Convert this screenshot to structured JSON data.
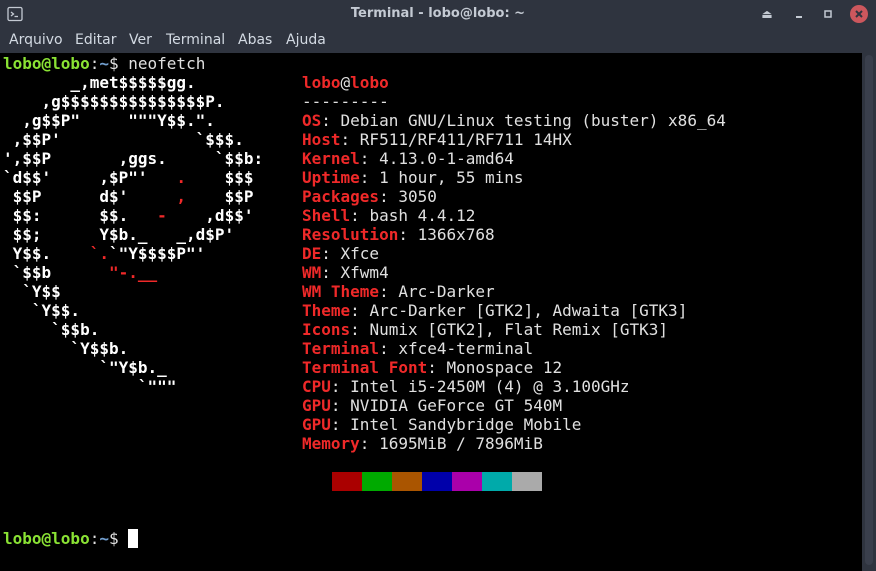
{
  "window": {
    "title": "Terminal - lobo@lobo: ~"
  },
  "menu": [
    "Arquivo",
    "Editar",
    "Ver",
    "Terminal",
    "Abas",
    "Ajuda"
  ],
  "prompt": {
    "user": "lobo@lobo",
    "sep": ":",
    "path": "~",
    "sigil": "$",
    "command": "neofetch"
  },
  "ascii_logo": [
    {
      "parts": [
        {
          "t": "       _,met$$$$$gg.",
          "c": "w"
        }
      ]
    },
    {
      "parts": [
        {
          "t": "    ,g$$$$$$$$$$$$$$$P.",
          "c": "w"
        }
      ]
    },
    {
      "parts": [
        {
          "t": "  ,g$$P\"     \"\"\"Y$$.\".",
          "c": "w"
        }
      ]
    },
    {
      "parts": [
        {
          "t": " ,$$P'              `$$$.",
          "c": "w"
        }
      ]
    },
    {
      "parts": [
        {
          "t": "',$$P       ,ggs.     `$$b:",
          "c": "w"
        }
      ]
    },
    {
      "parts": [
        {
          "t": "`d$$'     ,$P\"'   ",
          "c": "w"
        },
        {
          "t": ".",
          "c": "r"
        },
        {
          "t": "    $$$",
          "c": "w"
        }
      ]
    },
    {
      "parts": [
        {
          "t": " $$P      d$'     ",
          "c": "w"
        },
        {
          "t": ",",
          "c": "r"
        },
        {
          "t": "    $$P",
          "c": "w"
        }
      ]
    },
    {
      "parts": [
        {
          "t": " $$:      $$.   ",
          "c": "w"
        },
        {
          "t": "-",
          "c": "r"
        },
        {
          "t": "    ,d$$'",
          "c": "w"
        }
      ]
    },
    {
      "parts": [
        {
          "t": " $$;      Y$b._   _,d$P'",
          "c": "w"
        }
      ]
    },
    {
      "parts": [
        {
          "t": " Y$$.    ",
          "c": "w"
        },
        {
          "t": "`.",
          "c": "r"
        },
        {
          "t": "`\"Y$$$$P\"'",
          "c": "w"
        }
      ]
    },
    {
      "parts": [
        {
          "t": " `$$b      ",
          "c": "w"
        },
        {
          "t": "\"-.__",
          "c": "r"
        }
      ]
    },
    {
      "parts": [
        {
          "t": "  `Y$$",
          "c": "w"
        }
      ]
    },
    {
      "parts": [
        {
          "t": "   `Y$$.",
          "c": "w"
        }
      ]
    },
    {
      "parts": [
        {
          "t": "     `$$b.",
          "c": "w"
        }
      ]
    },
    {
      "parts": [
        {
          "t": "       `Y$$b.",
          "c": "w"
        }
      ]
    },
    {
      "parts": [
        {
          "t": "          `\"Y$b._",
          "c": "w"
        }
      ]
    },
    {
      "parts": [
        {
          "t": "              `\"\"\"",
          "c": "w"
        }
      ]
    }
  ],
  "info": {
    "header_user": "lobo",
    "header_at": "@",
    "header_host": "lobo",
    "separator": "---------",
    "lines": [
      {
        "label": "OS",
        "value": "Debian GNU/Linux testing (buster) x86_64"
      },
      {
        "label": "Host",
        "value": "RF511/RF411/RF711 14HX"
      },
      {
        "label": "Kernel",
        "value": "4.13.0-1-amd64"
      },
      {
        "label": "Uptime",
        "value": "1 hour, 55 mins"
      },
      {
        "label": "Packages",
        "value": "3050"
      },
      {
        "label": "Shell",
        "value": "bash 4.4.12"
      },
      {
        "label": "Resolution",
        "value": "1366x768"
      },
      {
        "label": "DE",
        "value": "Xfce"
      },
      {
        "label": "WM",
        "value": "Xfwm4"
      },
      {
        "label": "WM Theme",
        "value": "Arc-Darker"
      },
      {
        "label": "Theme",
        "value": "Arc-Darker [GTK2], Adwaita [GTK3]"
      },
      {
        "label": "Icons",
        "value": "Numix [GTK2], Flat Remix [GTK3]"
      },
      {
        "label": "Terminal",
        "value": "xfce4-terminal"
      },
      {
        "label": "Terminal Font",
        "value": "Monospace 12"
      },
      {
        "label": "CPU",
        "value": "Intel i5-2450M (4) @ 3.100GHz"
      },
      {
        "label": "GPU",
        "value": "NVIDIA GeForce GT 540M"
      },
      {
        "label": "GPU",
        "value": "Intel Sandybridge Mobile"
      },
      {
        "label": "Memory",
        "value": "1695MiB / 7896MiB"
      }
    ]
  },
  "palette": [
    "#aa0000",
    "#00aa00",
    "#aa5500",
    "#0000aa",
    "#aa00aa",
    "#00aaaa",
    "#aaaaaa"
  ],
  "colors": {
    "user_green": "#8ae234",
    "path_blue": "#729fcf",
    "label_red": "#ef2929",
    "chrome": "#2f343f"
  }
}
